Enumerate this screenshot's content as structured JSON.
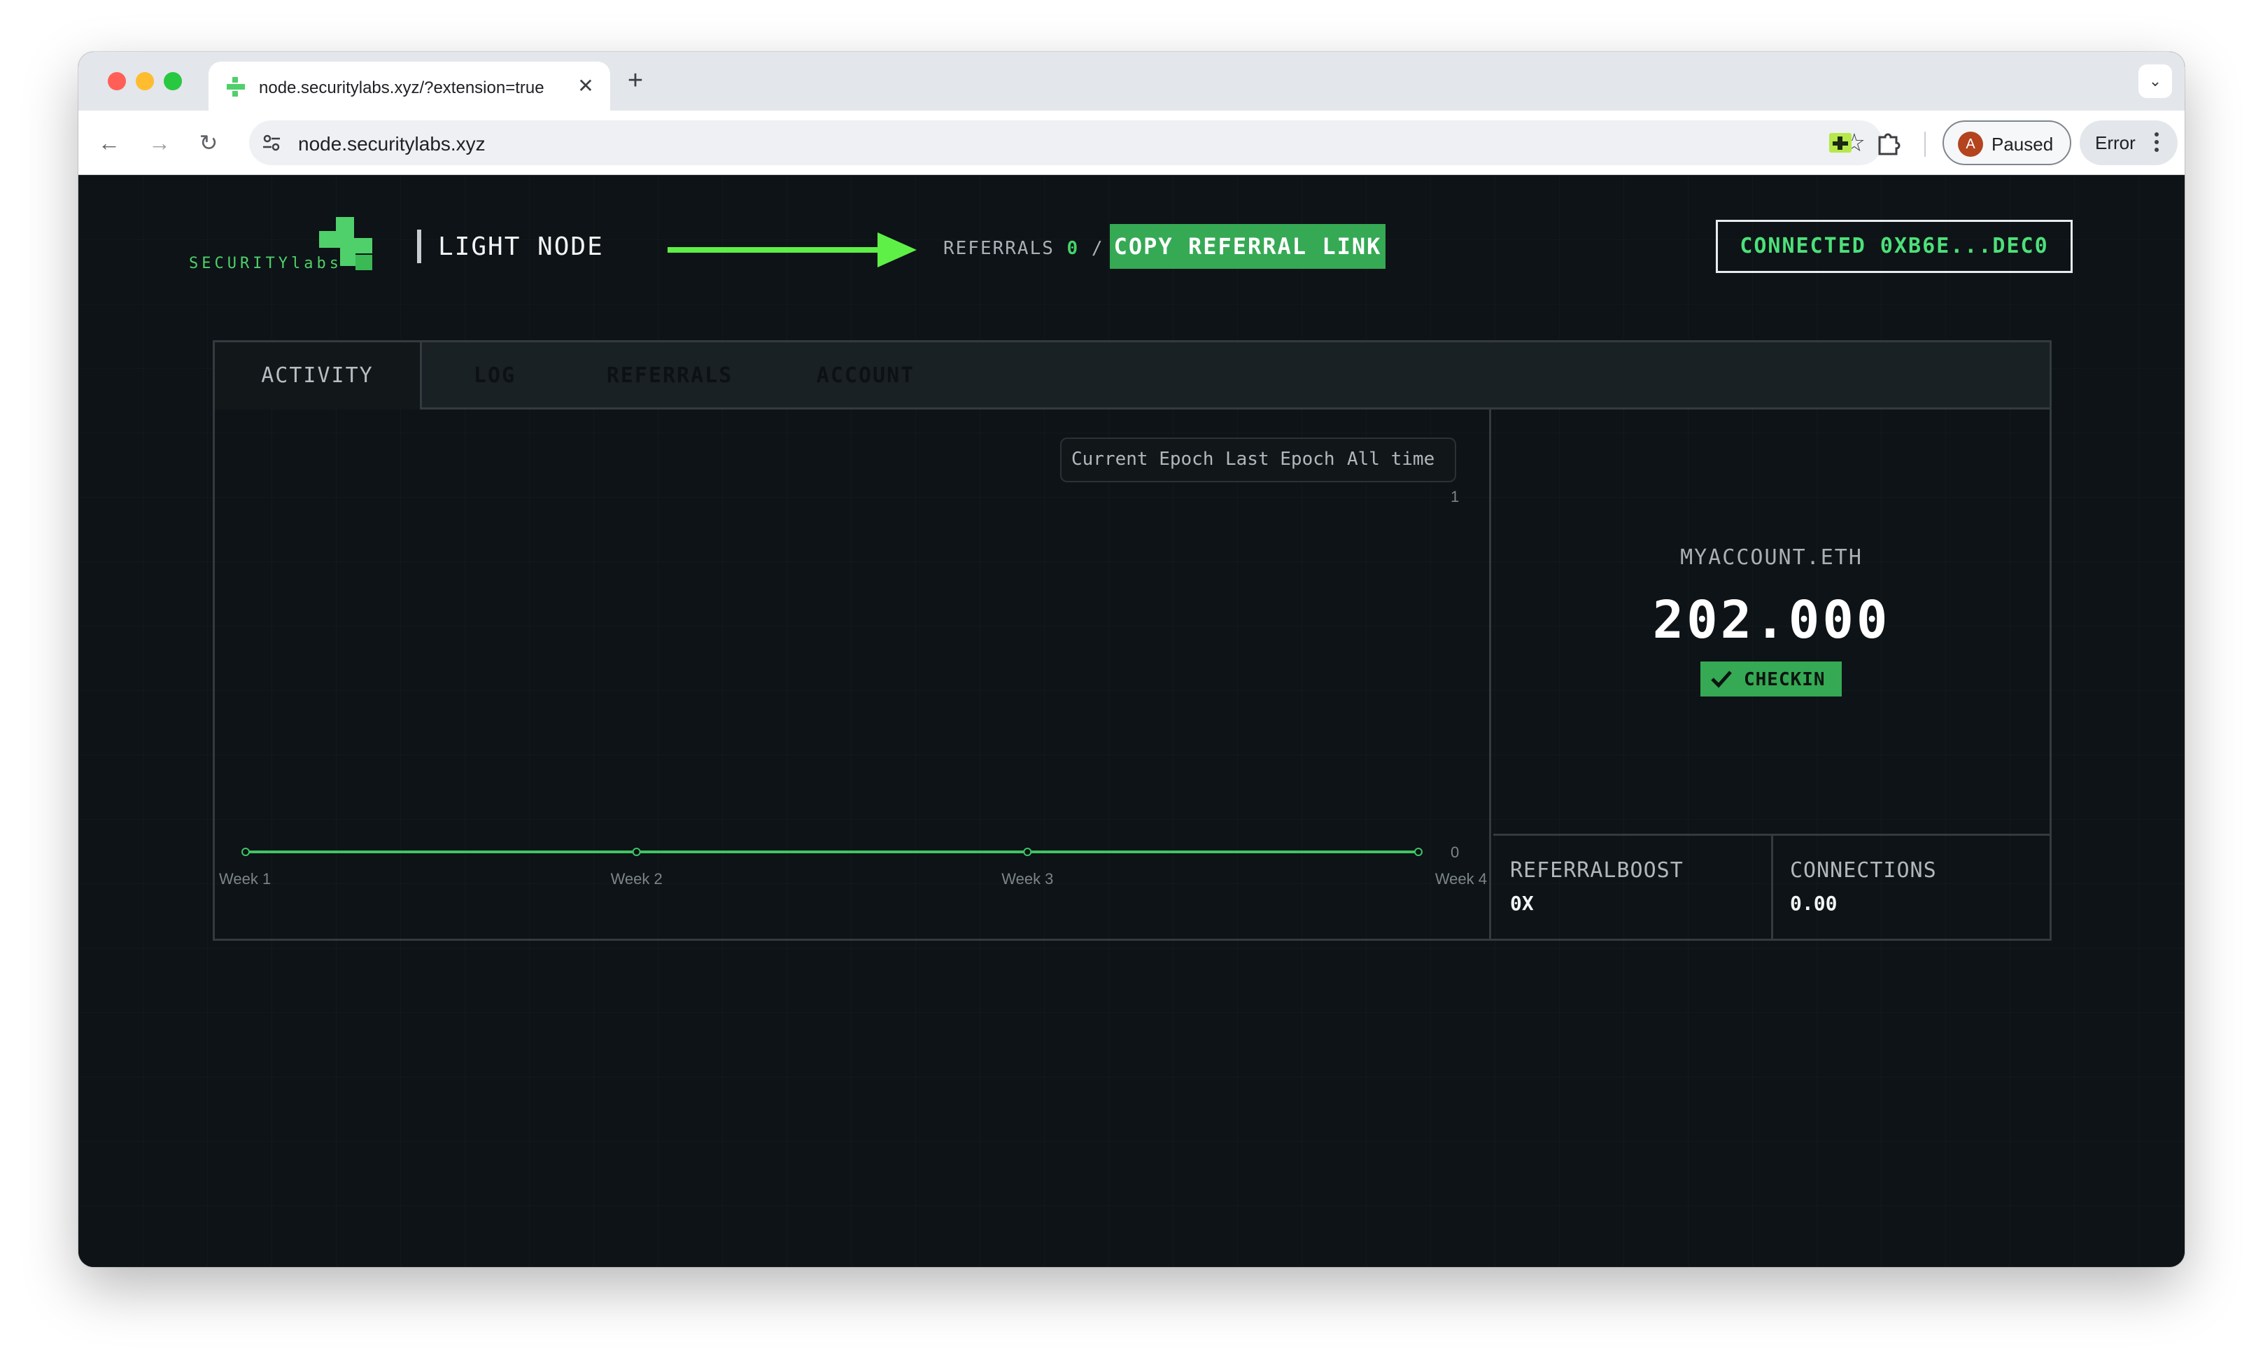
{
  "browser": {
    "tab_title": "node.securitylabs.xyz/?extension=true",
    "url": "node.securitylabs.xyz",
    "profile_label": "Paused",
    "profile_initial": "A",
    "error_label": "Error"
  },
  "header": {
    "logo_text": "SECURITYlabs",
    "node_title": "LIGHT NODE",
    "referrals_label": "REFERRALS",
    "referrals_count": "0",
    "referrals_separator": "/",
    "copy_referral_label": "COPY REFERRAL LINK",
    "connected_label": "CONNECTED 0XB6E...DEC0"
  },
  "tabs": [
    {
      "label": "ACTIVITY",
      "active": true
    },
    {
      "label": "LOG",
      "active": false
    },
    {
      "label": "REFERRALS",
      "active": false
    },
    {
      "label": "ACCOUNT",
      "active": false
    }
  ],
  "range_options": [
    "Current Epoch",
    "Last Epoch",
    "All time"
  ],
  "account": {
    "name": "MYACCOUNT.ETH",
    "balance": "202.000",
    "checkin_label": "CHECKIN"
  },
  "stats": [
    {
      "label": "REFERRALBOOST",
      "value": "0X"
    },
    {
      "label": "CONNECTIONS",
      "value": "0.00"
    }
  ],
  "colors": {
    "accent": "#35a954",
    "accent_bright": "#4de07a",
    "background": "#0d1316"
  },
  "chart_data": {
    "type": "line",
    "categories": [
      "Week 1",
      "Week 2",
      "Week 3",
      "Week 4"
    ],
    "series": [
      {
        "values": [
          0,
          0,
          0,
          0
        ]
      }
    ],
    "ylim": [
      0,
      1
    ],
    "yticks": [
      "1",
      "0"
    ],
    "grid": false,
    "title": "",
    "xlabel": "",
    "ylabel": ""
  }
}
